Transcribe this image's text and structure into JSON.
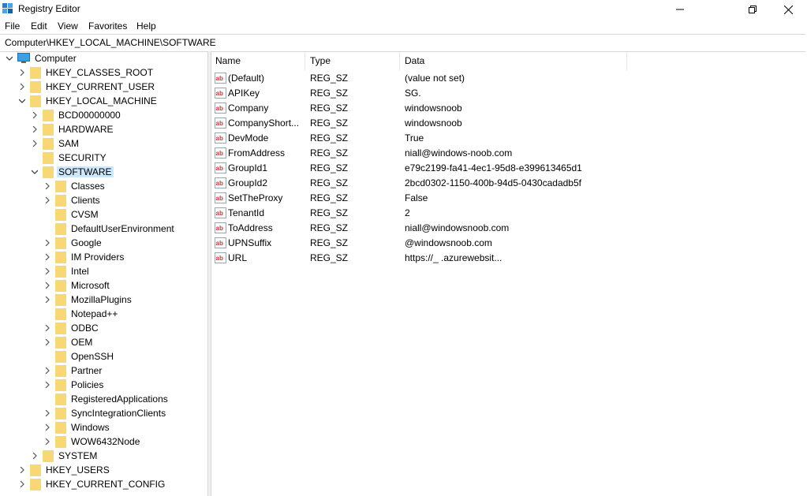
{
  "window": {
    "title": "Registry Editor",
    "icon": "registry-editor-icon"
  },
  "menu": [
    "File",
    "Edit",
    "View",
    "Favorites",
    "Help"
  ],
  "address": "Computer\\HKEY_LOCAL_MACHINE\\SOFTWARE",
  "tree": {
    "root": "Computer",
    "hives": {
      "classes_root": "HKEY_CLASSES_ROOT",
      "current_user": "HKEY_CURRENT_USER",
      "local_machine": "HKEY_LOCAL_MACHINE",
      "users": "HKEY_USERS",
      "current_config": "HKEY_CURRENT_CONFIG"
    },
    "hklm_children": [
      "BCD00000000",
      "HARDWARE",
      "SAM",
      "SECURITY",
      "SOFTWARE",
      "SYSTEM"
    ],
    "software_children": [
      "Classes",
      "Clients",
      "CVSM",
      "DefaultUserEnvironment",
      "Google",
      "IM Providers",
      "Intel",
      "Microsoft",
      "MozillaPlugins",
      "Notepad++",
      "ODBC",
      "OEM",
      "OpenSSH",
      "Partner",
      "Policies",
      "RegisteredApplications",
      "SyncIntegrationClients",
      "Windows",
      "WOW6432Node"
    ],
    "selected": "SOFTWARE"
  },
  "columns": {
    "name": "Name",
    "type": "Type",
    "data": "Data"
  },
  "values": [
    {
      "name": "(Default)",
      "type": "REG_SZ",
      "data": "(value not set)"
    },
    {
      "name": "APIKey",
      "type": "REG_SZ",
      "data": "SG."
    },
    {
      "name": "Company",
      "type": "REG_SZ",
      "data": "windowsnoob"
    },
    {
      "name": "CompanyShort...",
      "type": "REG_SZ",
      "data": "windowsnoob"
    },
    {
      "name": "DevMode",
      "type": "REG_SZ",
      "data": "True"
    },
    {
      "name": "FromAddress",
      "type": "REG_SZ",
      "data": "niall@windows-noob.com"
    },
    {
      "name": "GroupId1",
      "type": "REG_SZ",
      "data": "e79c2199-fa41-4ec1-95d8-e399613465d1"
    },
    {
      "name": "GroupId2",
      "type": "REG_SZ",
      "data": "2bcd0302-1150-400b-94d5-0430cadadb5f"
    },
    {
      "name": "SetTheProxy",
      "type": "REG_SZ",
      "data": "False"
    },
    {
      "name": "TenantId",
      "type": "REG_SZ",
      "data": "2"
    },
    {
      "name": "ToAddress",
      "type": "REG_SZ",
      "data": "niall@windowsnoob.com"
    },
    {
      "name": "UPNSuffix",
      "type": "REG_SZ",
      "data": "@windowsnoob.com"
    },
    {
      "name": "URL",
      "type": "REG_SZ",
      "data": "https://_ .azurewebsit..."
    }
  ],
  "colors": {
    "selection": "#cce8ff",
    "folder": "#f8d775",
    "ab_icon": "#d13438"
  }
}
